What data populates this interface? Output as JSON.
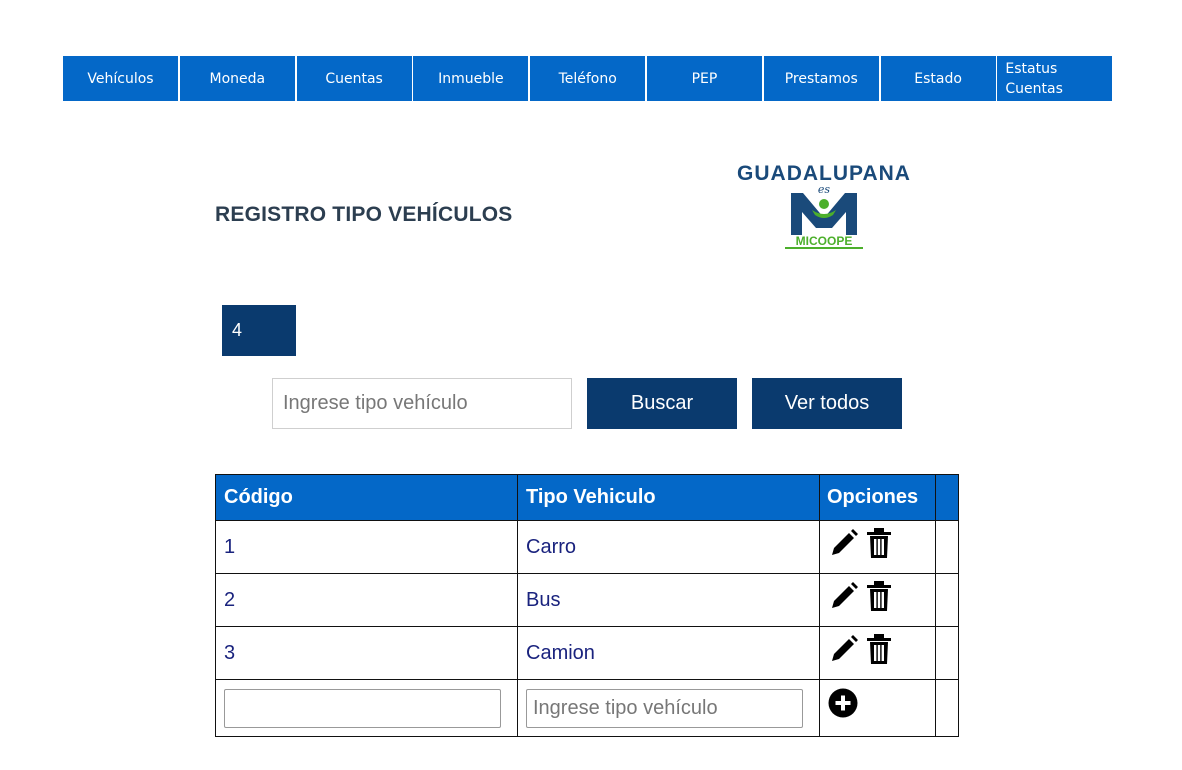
{
  "nav": {
    "items": [
      {
        "label": "Vehículos"
      },
      {
        "label": "Moneda"
      },
      {
        "label": "Cuentas"
      },
      {
        "label": "Inmueble"
      },
      {
        "label": "Teléfono"
      },
      {
        "label": "PEP"
      },
      {
        "label": "Prestamos"
      },
      {
        "label": "Estado"
      },
      {
        "label_line1": "Estatus",
        "label_line2": "Cuentas"
      }
    ]
  },
  "page": {
    "title": "REGISTRO TIPO VEHÍCULOS",
    "count": "4"
  },
  "logo": {
    "top_text": "GUADALUPANA",
    "script_text": "es",
    "bottom_text": "MICOOPE"
  },
  "search": {
    "placeholder": "Ingrese tipo vehículo",
    "search_label": "Buscar",
    "view_all_label": "Ver todos"
  },
  "table": {
    "headers": {
      "code": "Código",
      "type": "Tipo Vehiculo",
      "options": "Opciones"
    },
    "rows": [
      {
        "code": "1",
        "type": "Carro"
      },
      {
        "code": "2",
        "type": "Bus"
      },
      {
        "code": "3",
        "type": "Camion"
      }
    ],
    "new_row": {
      "code_value": "",
      "type_placeholder": "Ingrese tipo vehículo"
    }
  },
  "colors": {
    "nav_bg": "#0468c8",
    "button_bg": "#0a3a6e",
    "logo_navy": "#1a4a7a",
    "logo_green": "#4caf2b"
  },
  "icons": [
    "edit-icon",
    "trash-icon",
    "add-circle-icon"
  ]
}
